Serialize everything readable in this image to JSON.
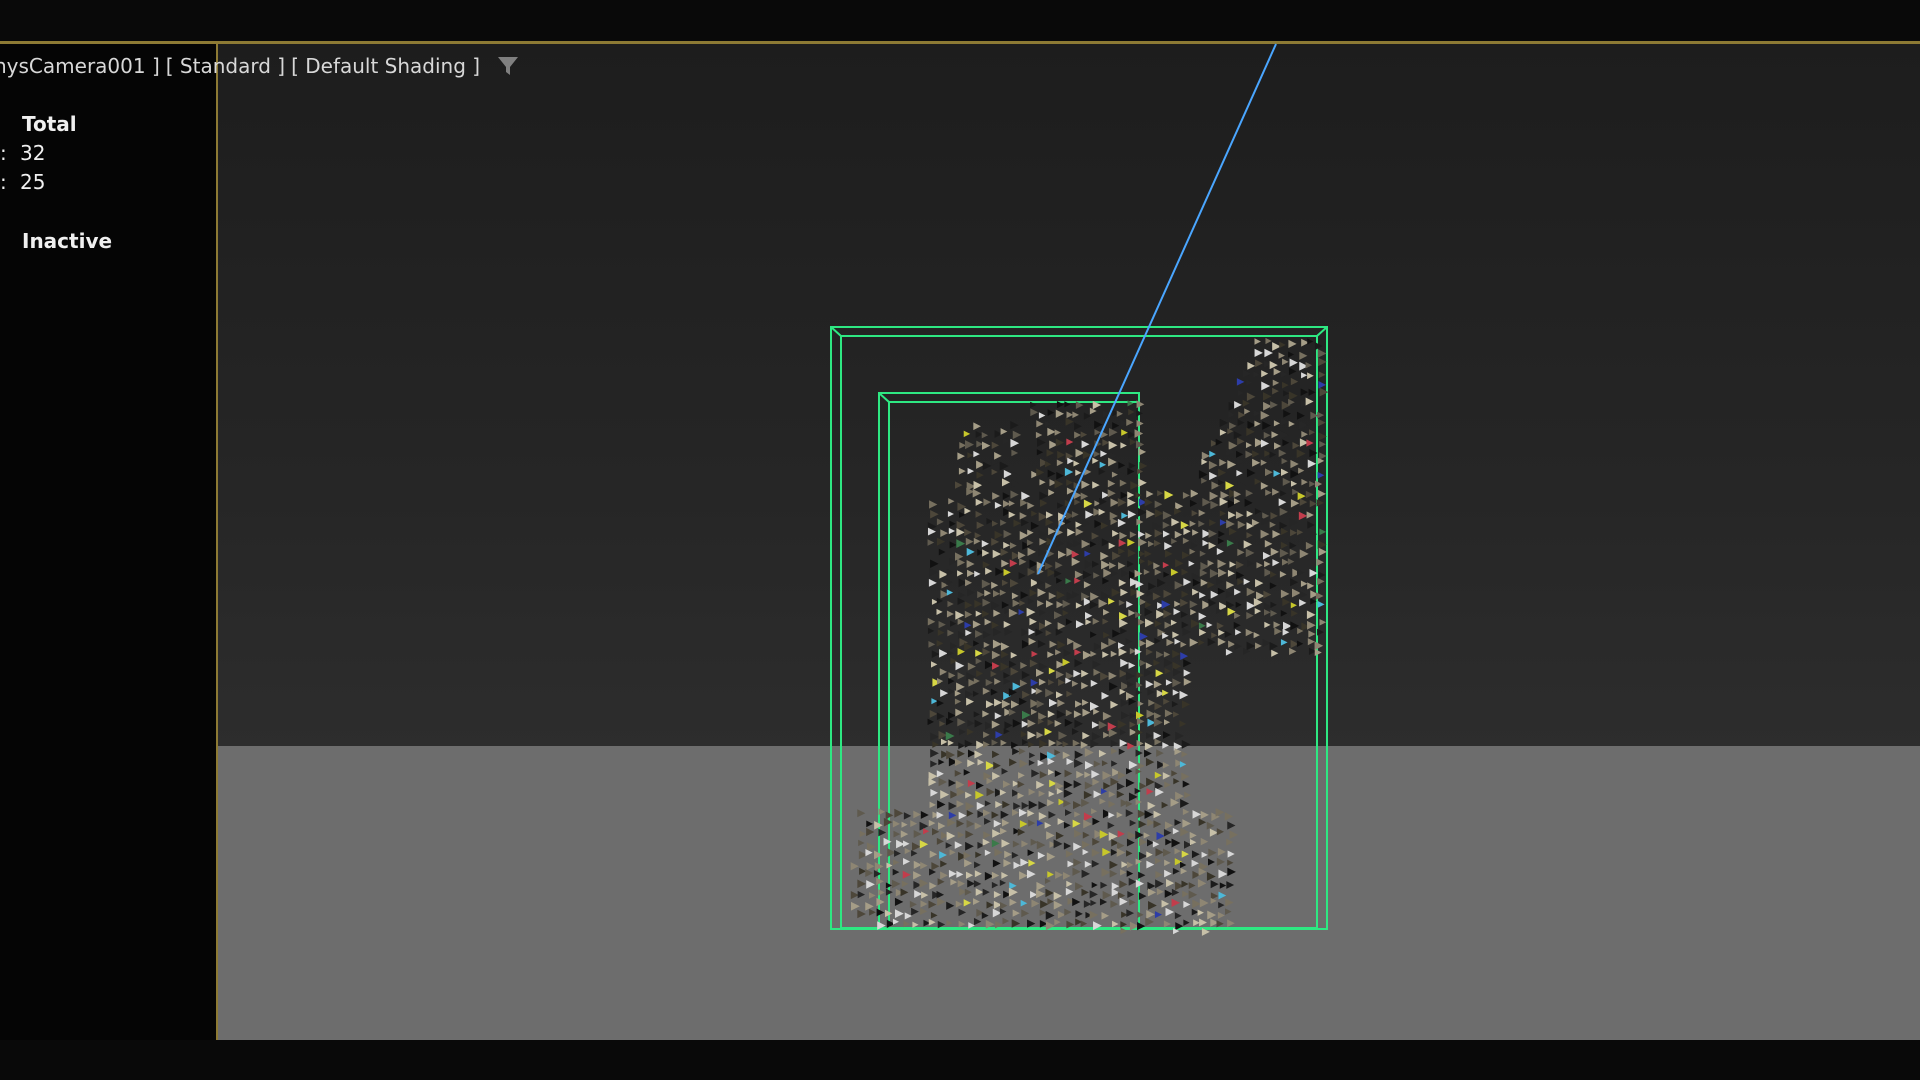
{
  "viewport": {
    "camera": "nysCamera001 ]",
    "mode": "[ Standard ]",
    "shading": "[ Default Shading ]"
  },
  "stats": {
    "header": "Total",
    "row1_label": ":",
    "row1_value": "32",
    "row2_label": ":",
    "row2_value": "25",
    "state": "Inactive"
  },
  "icons": {
    "filter": "filter-icon"
  },
  "colors": {
    "accent_border": "#8d7a34",
    "helper_box": "#2ee882",
    "camera_line": "#4aa6ff",
    "floor": "#6d6d6d"
  }
}
